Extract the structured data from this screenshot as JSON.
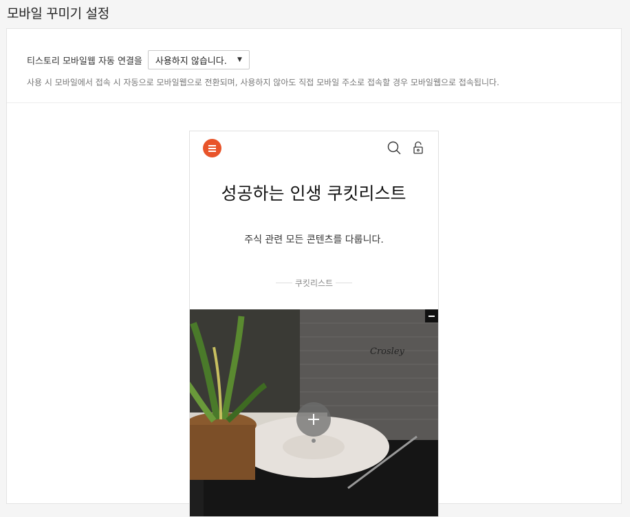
{
  "page": {
    "title": "모바일 꾸미기 설정"
  },
  "setting": {
    "label": "티스토리 모바일웹 자동 연결을",
    "selected": "사용하지 않습니다.",
    "help": "사용 시 모바일에서 접속 시 자동으로 모바일웹으로 전환되며, 사용하지 않아도 직접 모바일 주소로 접속할 경우 모바일웹으로 접속됩니다."
  },
  "preview": {
    "blog_title": "성공하는 인생 쿠킷리스트",
    "blog_desc": "주식 관련 모든 콘텐츠를 다룹니다.",
    "category": "쿠킷리스트",
    "icons": {
      "menu": "hamburger-menu-icon",
      "search": "search-icon",
      "lock": "lock-icon",
      "collapse": "minus-icon",
      "add": "plus-icon"
    },
    "cover_brand": "Crosley"
  },
  "colors": {
    "accent": "#e8542a"
  }
}
